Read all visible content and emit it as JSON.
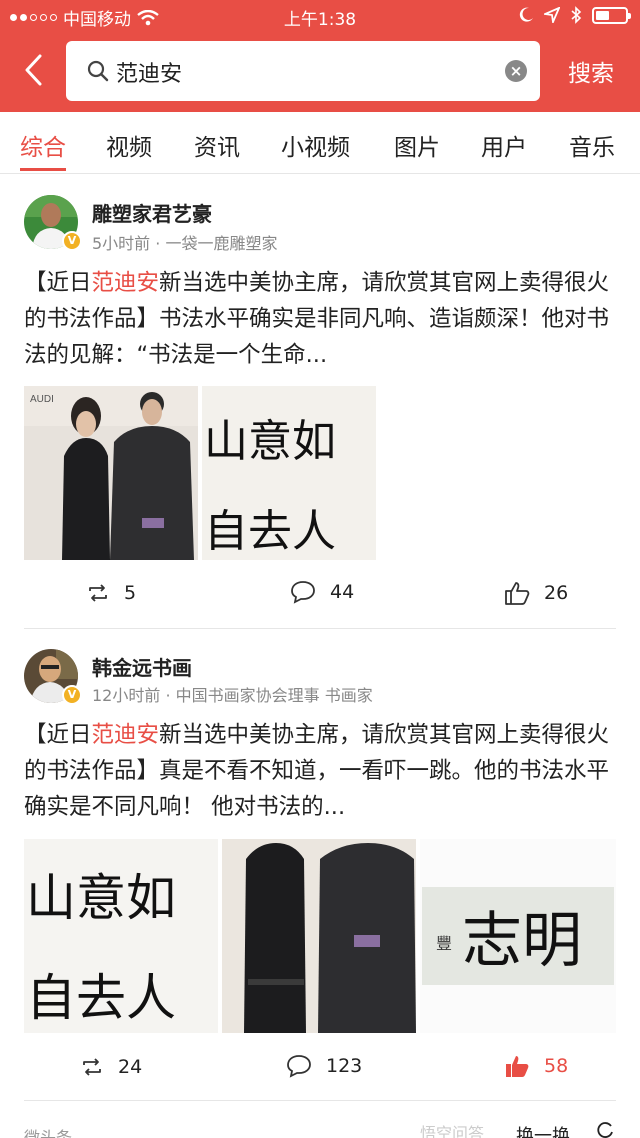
{
  "status_bar": {
    "carrier": "中国移动",
    "time": "上午1:38"
  },
  "search": {
    "query": "范迪安",
    "button_label": "搜索"
  },
  "tabs": [
    {
      "label": "综合",
      "active": true
    },
    {
      "label": "视频",
      "active": false
    },
    {
      "label": "资讯",
      "active": false
    },
    {
      "label": "小视频",
      "active": false
    },
    {
      "label": "图片",
      "active": false
    },
    {
      "label": "用户",
      "active": false
    },
    {
      "label": "音乐",
      "active": false
    }
  ],
  "posts": [
    {
      "author": "雕塑家君艺豪",
      "meta": "5小时前 · 一袋一鹿雕塑家",
      "text_pre": "【近日",
      "text_highlight": "范迪安",
      "text_post": "新当选中美协主席，请欣赏其官网上卖得很火的书法作品】书法水平确实是非同凡响、造诣颇深！他对书法的见解：“书法是一个生命...",
      "retweets": "5",
      "comments": "44",
      "likes": "26",
      "liked": false
    },
    {
      "author": "韩金远书画",
      "meta": "12小时前 · 中国书画家协会理事 书画家",
      "text_pre": "【近日",
      "text_highlight": "范迪安",
      "text_post": "新当选中美协主席，请欣赏其官网上卖得很火的书法作品】真是不看不知道，一看吓一跳。他的书法水平确实是不同凡响！ 他对书法的...",
      "retweets": "24",
      "comments": "123",
      "likes": "58",
      "liked": true
    }
  ],
  "images": {
    "calligraphy_left": "山意如",
    "calligraphy_left_2": "自去人",
    "calligraphy_right": "志明",
    "calligraphy_sign": "豐"
  },
  "footer": {
    "left": "微头条",
    "right": "换一换",
    "watermark": "悟空问答"
  },
  "colors": {
    "accent": "#e84e45",
    "verified": "#f2b124"
  }
}
